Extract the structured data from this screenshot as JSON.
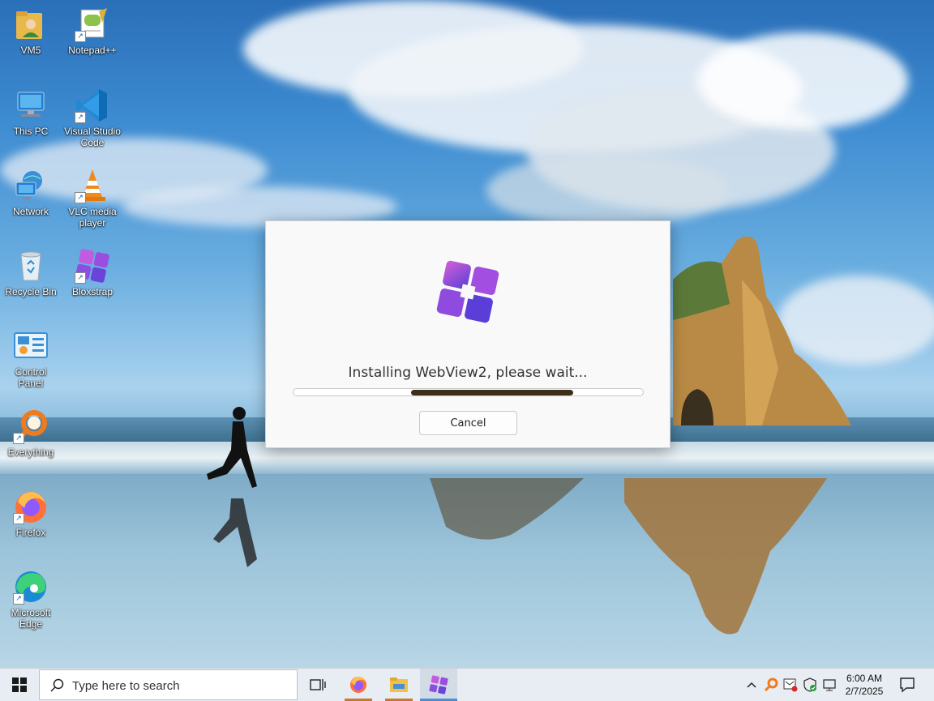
{
  "desktop": {
    "icons": [
      {
        "label": "VM5"
      },
      {
        "label": "Notepad++"
      },
      {
        "label": "This PC"
      },
      {
        "label": "Visual Studio Code"
      },
      {
        "label": "Network"
      },
      {
        "label": "VLC media player"
      },
      {
        "label": "Recycle Bin"
      },
      {
        "label": "Bloxstrap"
      },
      {
        "label": "Control Panel"
      },
      {
        "label": "Everything"
      },
      {
        "label": "Firefox"
      },
      {
        "label": "Microsoft Edge"
      }
    ]
  },
  "dialog": {
    "status_text": "Installing WebView2, please wait...",
    "progress": "indeterminate",
    "cancel_label": "Cancel",
    "accent_color": "#3d2e1a"
  },
  "taskbar": {
    "search_placeholder": "Type here to search",
    "pinned": [
      {
        "icon": "task-view-icon"
      },
      {
        "icon": "firefox-icon",
        "running": true
      },
      {
        "icon": "file-explorer-icon",
        "running": true
      },
      {
        "icon": "bloxstrap-icon",
        "running": true,
        "active": true
      }
    ],
    "tray": {
      "time": "6:00 AM",
      "date": "2/7/2025"
    }
  }
}
